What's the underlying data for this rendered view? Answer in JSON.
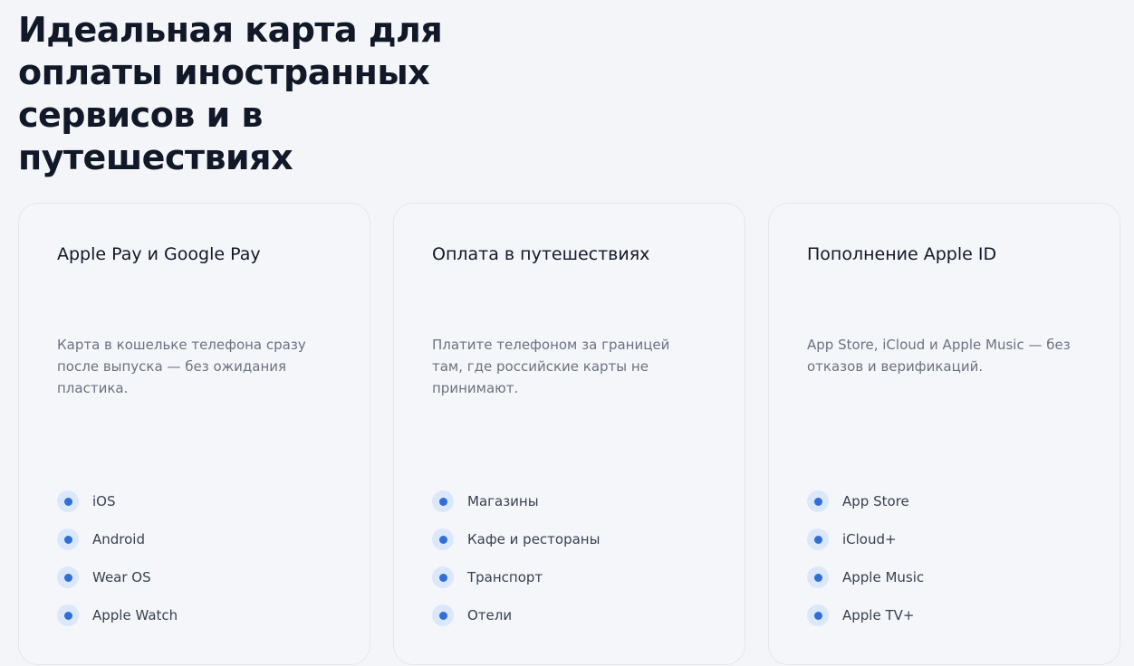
{
  "hero": {
    "title": "Идеальная карта для оплаты иностранных сервисов и в путешествиях"
  },
  "theme": {
    "bullet_ring": "#dbe8fb",
    "bullet_dot": "#2f6fd6"
  },
  "cards": [
    {
      "title": "Apple Pay и Google Pay",
      "description": "Карта в кошельке телефона сразу после выпуска — без ожидания пластика.",
      "items": [
        "iOS",
        "Android",
        "Wear OS",
        "Apple Watch"
      ]
    },
    {
      "title": "Оплата в путешествиях",
      "description": "Платите телефоном за границей там, где российские карты не принимают.",
      "items": [
        "Магазины",
        "Кафе и рестораны",
        "Транспорт",
        "Отели"
      ]
    },
    {
      "title": "Пополнение Apple ID",
      "description": "App Store, iCloud и Apple Music — без отказов и верификаций.",
      "items": [
        "App Store",
        "iCloud+",
        "Apple Music",
        "Apple TV+"
      ]
    }
  ]
}
